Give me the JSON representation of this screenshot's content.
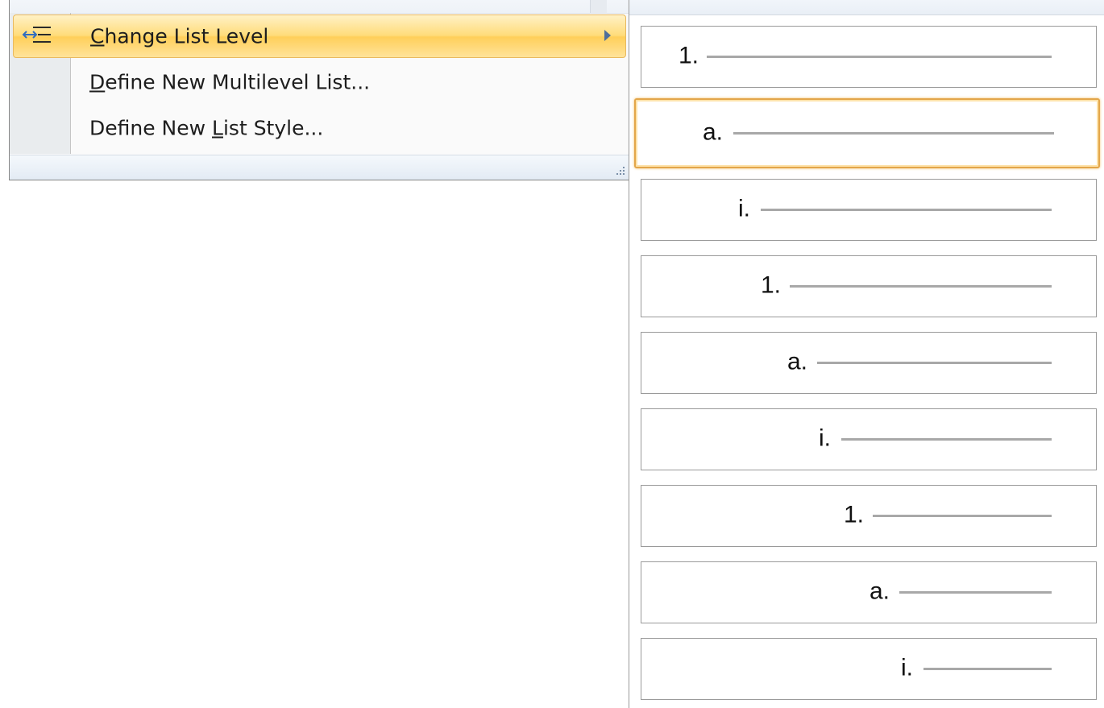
{
  "menu": {
    "items": [
      {
        "label_accel": "C",
        "label_rest": "hange List Level",
        "has_submenu": true,
        "highlighted": true,
        "icon": "change-list-level-icon"
      },
      {
        "label_accel": "D",
        "label_rest": "efine New Multilevel List...",
        "has_submenu": false,
        "highlighted": false
      },
      {
        "label_pre": "Define New ",
        "label_accel": "L",
        "label_rest": "ist Style...",
        "has_submenu": false,
        "highlighted": false
      }
    ]
  },
  "submenu": {
    "levels": [
      {
        "marker": "1."
      },
      {
        "marker": "a.",
        "selected": true
      },
      {
        "marker": "i."
      },
      {
        "marker": "1."
      },
      {
        "marker": "a."
      },
      {
        "marker": "i."
      },
      {
        "marker": "1."
      },
      {
        "marker": "a."
      },
      {
        "marker": "i."
      }
    ]
  },
  "colors": {
    "highlight_top": "#fff1c5",
    "highlight_mid": "#ffcf5a",
    "highlight_border": "#e9b95f",
    "selected_border": "#e3a64a",
    "rule_gray": "#a8a8a8"
  }
}
